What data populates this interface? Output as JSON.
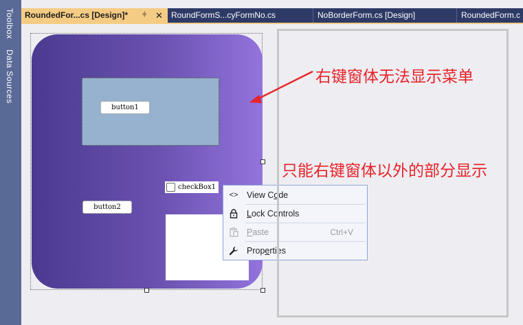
{
  "side_panel": {
    "toolbox": "Toolbox",
    "data_sources": "Data Sources"
  },
  "tabs": [
    {
      "label": "RoundedFor...cs [Design]*",
      "active": true,
      "pin_icon": "pin-icon",
      "close_icon": "close-icon"
    },
    {
      "label": "RoundFormS...cyFormNo.cs",
      "active": false
    },
    {
      "label": "NoBorderForm.cs [Design]",
      "active": false
    },
    {
      "label": "RoundedForm.c",
      "active": false
    }
  ],
  "form": {
    "button1": "button1",
    "button2": "button2",
    "checkbox": {
      "label": "checkBox1",
      "checked": false
    }
  },
  "context_menu": {
    "items": [
      {
        "label": "View Code",
        "icon": "code-icon",
        "enabled": true,
        "shortcut": ""
      },
      {
        "label": "Lock Controls",
        "icon": "lock-icon",
        "enabled": true,
        "shortcut": ""
      },
      {
        "label": "Paste",
        "icon": "paste-icon",
        "enabled": false,
        "shortcut": "Ctrl+V"
      },
      {
        "label": "Properties",
        "icon": "wrench-icon",
        "enabled": true,
        "shortcut": ""
      }
    ]
  },
  "annotations": {
    "top": "右键窗体无法显示菜单",
    "bottom": "只能右键窗体以外的部分显示"
  },
  "colors": {
    "accent_tab": "#f5cc84",
    "annotation_red": "#e6232a",
    "menu_border": "#8ea4d9",
    "form_gradient_start": "#4b3a90",
    "form_gradient_end": "#9373dc"
  }
}
